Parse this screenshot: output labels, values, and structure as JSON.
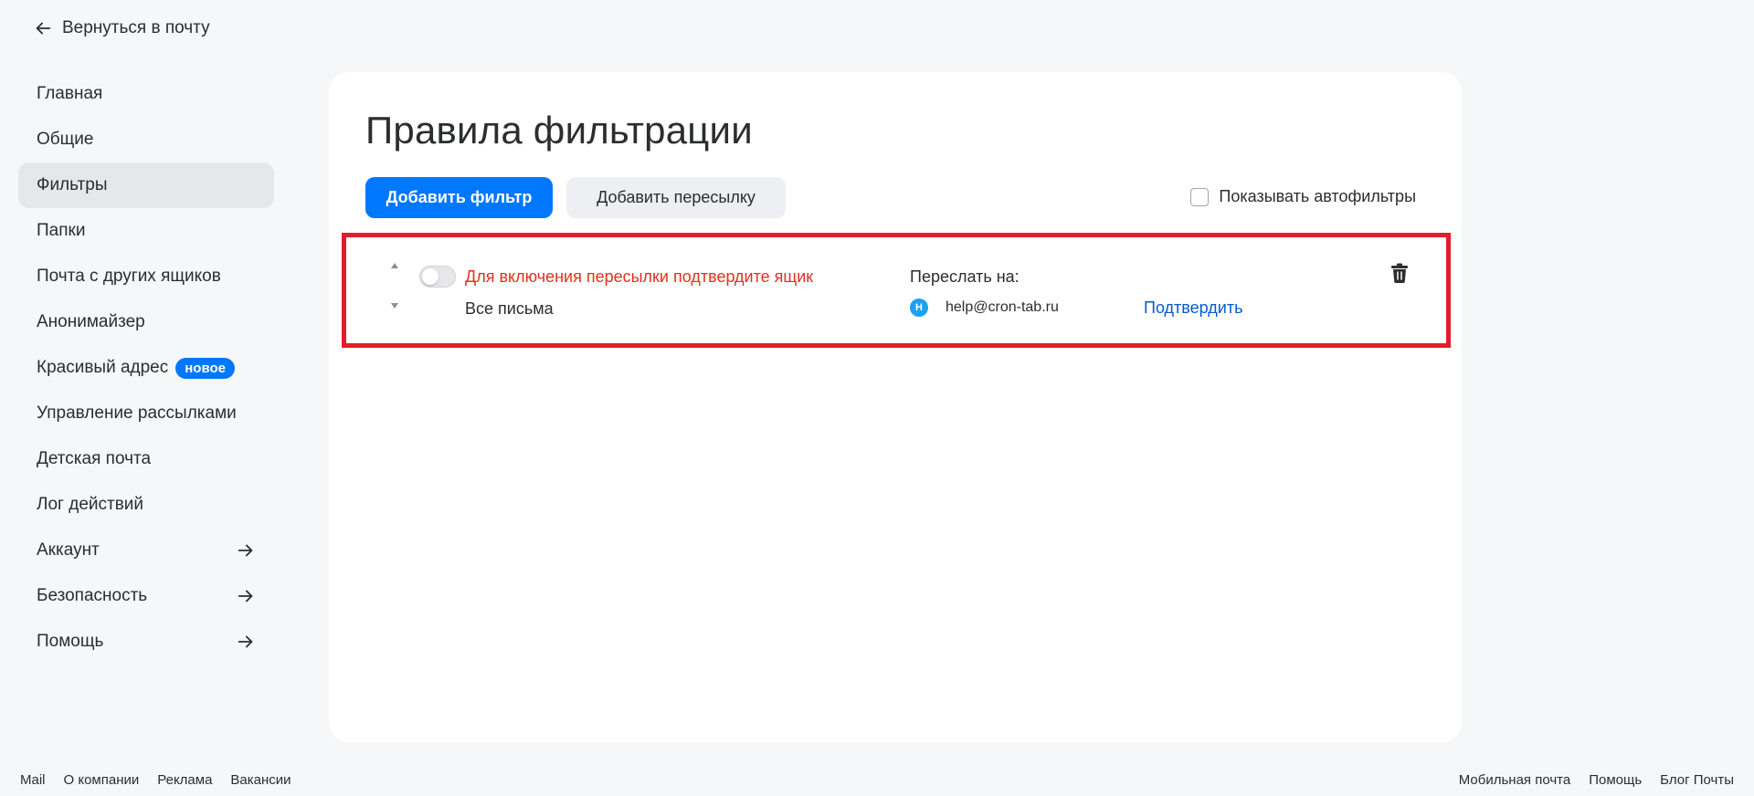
{
  "back_link": {
    "label": "Вернуться в почту"
  },
  "sidebar": {
    "items": [
      {
        "label": "Главная"
      },
      {
        "label": "Общие"
      },
      {
        "label": "Фильтры"
      },
      {
        "label": "Папки"
      },
      {
        "label": "Почта с других ящиков"
      },
      {
        "label": "Анонимайзер"
      },
      {
        "label": "Красивый адрес",
        "badge": "новое"
      },
      {
        "label": "Управление рассылками"
      },
      {
        "label": "Детская почта"
      },
      {
        "label": "Лог действий"
      },
      {
        "label": "Аккаунт"
      },
      {
        "label": "Безопасность"
      },
      {
        "label": "Помощь"
      }
    ],
    "active_index": 2
  },
  "main": {
    "title": "Правила фильтрации",
    "add_filter_label": "Добавить фильтр",
    "add_forward_label": "Добавить пересылку",
    "show_autofilters_label": "Показывать автофильтры",
    "show_autofilters_checked": false
  },
  "filter": {
    "enabled": false,
    "warning": "Для включения пересылки подтвердите ящик",
    "condition": "Все письма",
    "forward_label": "Переслать на:",
    "avatar_letter": "H",
    "email": "help@cron-tab.ru",
    "confirm_label": "Подтвердить"
  },
  "footer": {
    "left": [
      "Mail",
      "О компании",
      "Реклама",
      "Вакансии"
    ],
    "right": [
      "Мобильная почта",
      "Помощь",
      "Блог Почты"
    ]
  },
  "colors": {
    "accent": "#0077ff",
    "warning": "#e0311f",
    "link": "#005bd1",
    "highlight_border": "#e21d2b"
  }
}
